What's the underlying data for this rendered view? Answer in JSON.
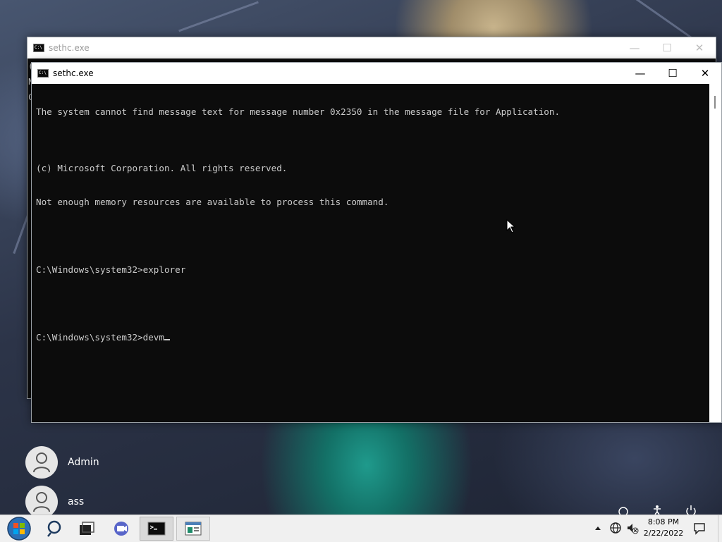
{
  "desktop": {
    "users": [
      {
        "name": "Admin"
      },
      {
        "name": "ass"
      }
    ]
  },
  "back_window": {
    "title": "sethc.exe",
    "partial_lines": [
      "(",
      "N",
      "C"
    ]
  },
  "front_window": {
    "title": "sethc.exe",
    "console_lines": [
      "The system cannot find message text for message number 0x2350 in the message file for Application.",
      "",
      "(c) Microsoft Corporation. All rights reserved.",
      "Not enough memory resources are available to process this command.",
      "",
      "C:\\Windows\\system32>explorer",
      "",
      "C:\\Windows\\system32>devm"
    ]
  },
  "taskbar": {
    "items": [
      "start-orb",
      "search",
      "task-view",
      "meet-now",
      "command-prompt",
      "app"
    ],
    "clock_time": "8:08 PM",
    "clock_date": "2/22/2022"
  },
  "colors": {
    "console_bg": "#0c0c0c",
    "console_fg": "#cccccc",
    "taskbar_bg": "#f0f0f0"
  }
}
